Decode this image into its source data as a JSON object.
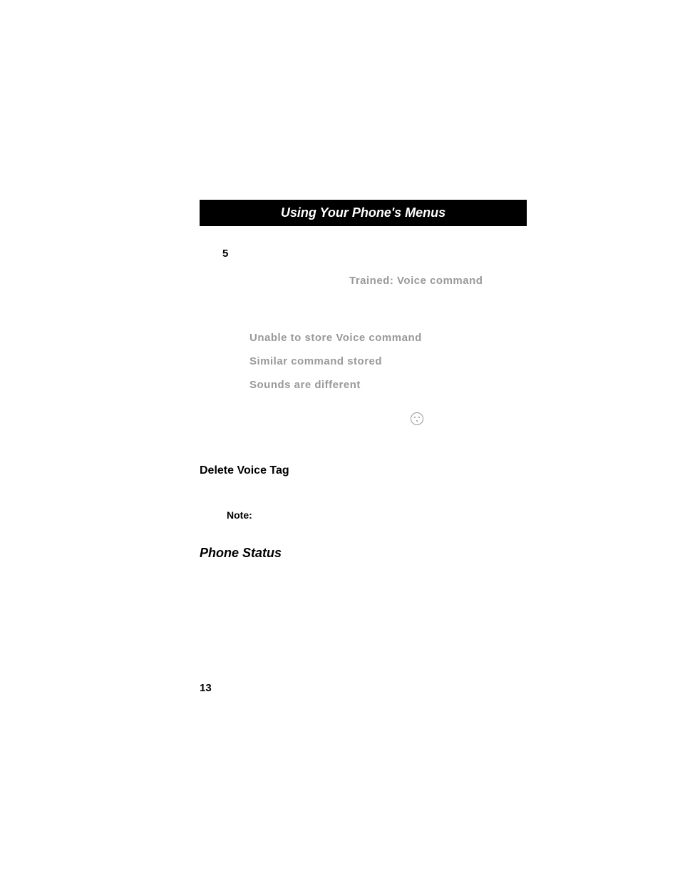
{
  "header": {
    "title": "Using Your Phone's Menus"
  },
  "step": {
    "number": "5"
  },
  "trained": "Trained: Voice command",
  "errors": {
    "line1": "Unable to store Voice command",
    "line2": "Similar command stored",
    "line3": "Sounds are different"
  },
  "sections": {
    "deleteVoiceTag": "Delete Voice Tag",
    "note": "Note:",
    "phoneStatus": "Phone Status"
  },
  "pageNumber": "13"
}
